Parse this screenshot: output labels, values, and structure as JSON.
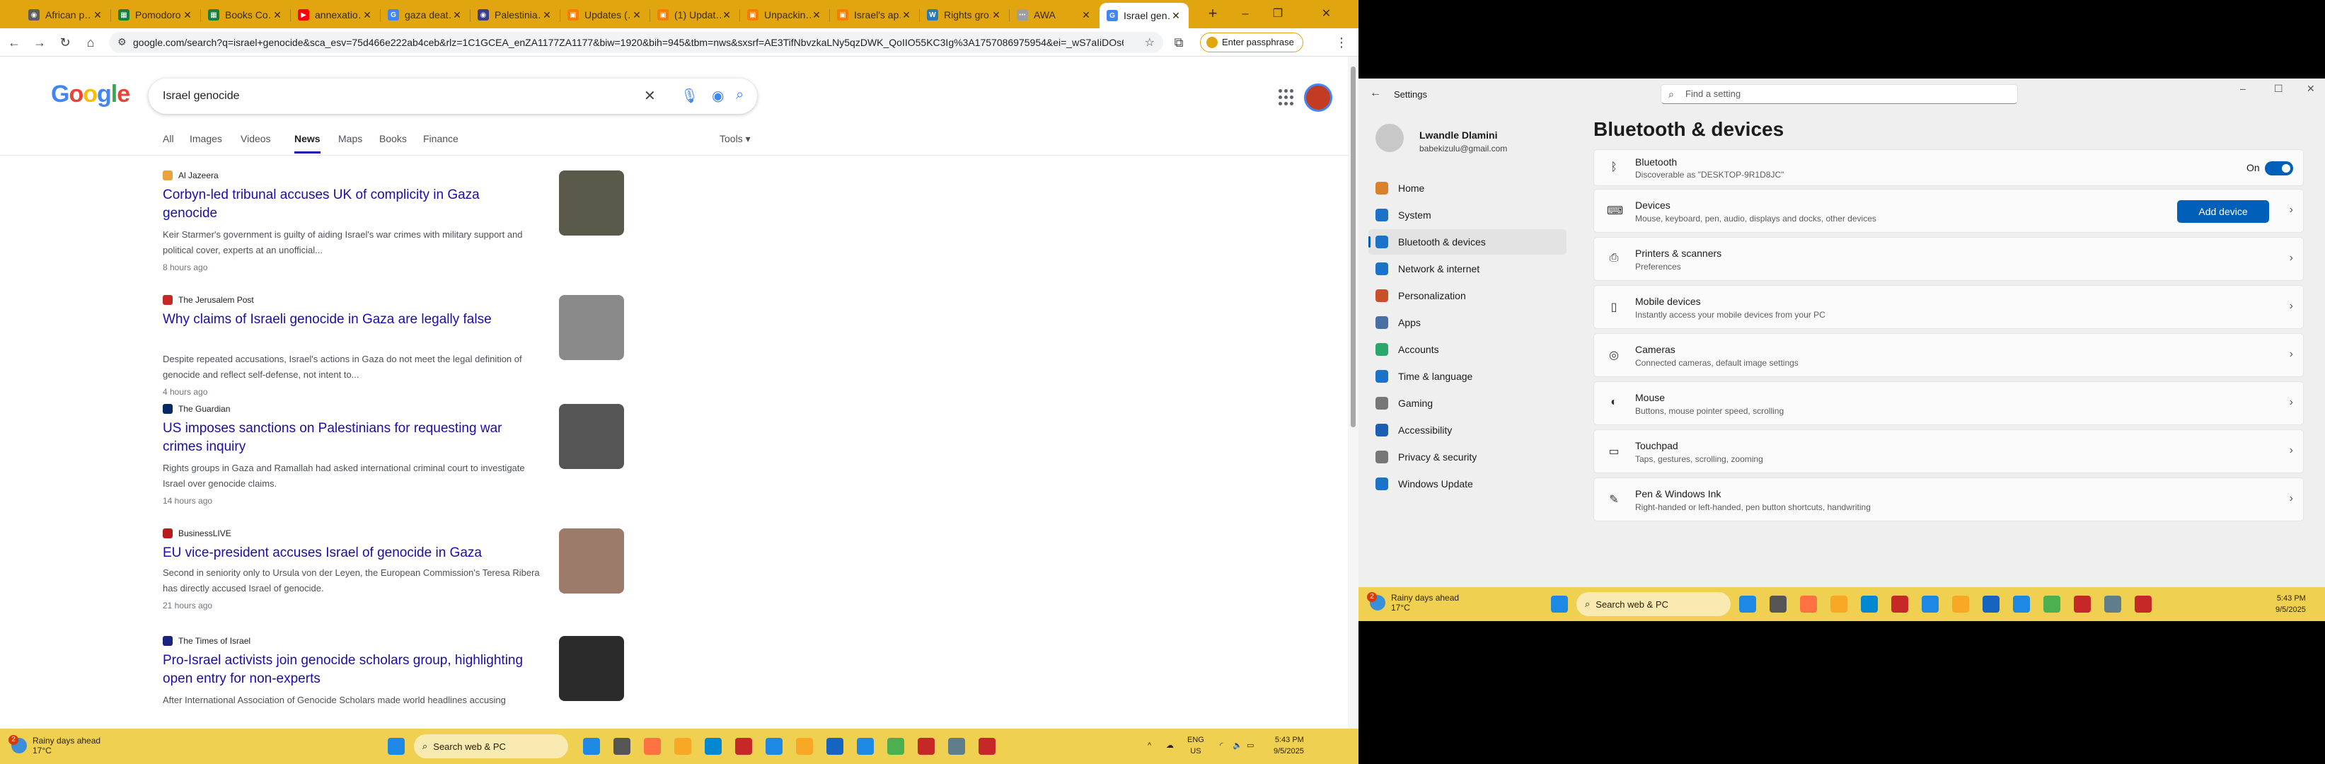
{
  "browser": {
    "tabs": [
      {
        "label": "African p…",
        "color": "#5c5c5c",
        "glyph": "◉"
      },
      {
        "label": "Pomodoro",
        "color": "#188038",
        "glyph": "▦"
      },
      {
        "label": "Books Co…",
        "color": "#188038",
        "glyph": "▦"
      },
      {
        "label": "annexatio…",
        "color": "#ff0000",
        "glyph": "▶"
      },
      {
        "label": "gaza deat…",
        "color": "#4285f4",
        "glyph": "G"
      },
      {
        "label": "Palestinia…",
        "color": "#3c3c8c",
        "glyph": "◉"
      },
      {
        "label": "Updates (…",
        "color": "#f57c00",
        "glyph": "▣"
      },
      {
        "label": "(1) Updat…",
        "color": "#f57c00",
        "glyph": "▣"
      },
      {
        "label": "Unpackin…",
        "color": "#f57c00",
        "glyph": "▣"
      },
      {
        "label": "Israel's ap…",
        "color": "#f57c00",
        "glyph": "▣"
      },
      {
        "label": "Rights gro…",
        "color": "#2a7ab8",
        "glyph": "W"
      },
      {
        "label": "AWA",
        "color": "#9e9e9e",
        "glyph": "⋯"
      },
      {
        "label": "Israel gen…",
        "color": "#4285f4",
        "glyph": "G"
      }
    ],
    "url": "google.com/search?q=israel+genocide&sca_esv=75d466e222ab4ceb&rlz=1C1GCEA_enZA1177ZA1177&biw=1920&bih=945&tbm=nws&sxsrf=AE3TifNbvzkaLNy5qzDWK_QoIIO55KC3Ig%3A1757086975954&ei=_wS7aIiDOs6Xxc8P...",
    "passphrase": "Enter passphrase"
  },
  "google": {
    "logo": "Google",
    "query": "Israel genocide",
    "tabs": [
      "All",
      "Images",
      "Videos",
      "News",
      "Maps",
      "Books",
      "Finance"
    ],
    "active_tab": "News",
    "tools": "Tools ▾",
    "results": [
      {
        "source": "Al Jazeera",
        "src_color": "#e8a33d",
        "title": "Corbyn-led tribunal accuses UK of complicity in Gaza genocide",
        "snippet": "Keir Starmer's government is guilty of aiding Israel's war crimes with military support and political cover, experts at an unofficial...",
        "age": "8 hours ago",
        "thumb": "#5a5a4a"
      },
      {
        "source": "The Jerusalem Post",
        "src_color": "#c62828",
        "title": "Why claims of Israeli genocide in Gaza are legally false",
        "snippet": "Despite repeated accusations, Israel's actions in Gaza do not meet the legal definition of genocide and reflect self-defense, not intent to...",
        "age": "4 hours ago",
        "thumb": "#8a8a8a"
      },
      {
        "source": "The Guardian",
        "src_color": "#052962",
        "title": "US imposes sanctions on Palestinians for requesting war crimes inquiry",
        "snippet": "Rights groups in Gaza and Ramallah had asked international criminal court to investigate Israel over genocide claims.",
        "age": "14 hours ago",
        "thumb": "#555555"
      },
      {
        "source": "BusinessLIVE",
        "src_color": "#b71c1c",
        "title": "EU vice-president accuses Israel of genocide in Gaza",
        "snippet": "Second in seniority only to Ursula von der Leyen, the European Commission's Teresa Ribera has directly accused Israel of genocide.",
        "age": "21 hours ago",
        "thumb": "#9c7b6a"
      },
      {
        "source": "The Times of Israel",
        "src_color": "#1a237e",
        "title": "Pro-Israel activists join genocide scholars group, highlighting open entry for non-experts",
        "snippet": "After International Association of Genocide Scholars made world headlines accusing",
        "age": "",
        "thumb": "#2b2b2b"
      }
    ]
  },
  "taskbar_left": {
    "weather_badge": "2",
    "weather_line1": "Rainy days ahead",
    "weather_line2": "17°C",
    "search": "Search web & PC",
    "lang1": "ENG",
    "lang2": "US",
    "time": "5:43 PM",
    "date": "9/5/2025",
    "tray_chevron": "^"
  },
  "settings": {
    "app_title": "Settings",
    "find_placeholder": "Find a setting",
    "profile_name": "Lwandle Dlamini",
    "profile_email": "babekizulu@gmail.com",
    "nav": [
      {
        "label": "Home",
        "color": "#d9822b"
      },
      {
        "label": "System",
        "color": "#1a73c8"
      },
      {
        "label": "Bluetooth & devices",
        "color": "#1a73c8"
      },
      {
        "label": "Network & internet",
        "color": "#1a73c8"
      },
      {
        "label": "Personalization",
        "color": "#c94f2b"
      },
      {
        "label": "Apps",
        "color": "#4a6fa5"
      },
      {
        "label": "Accounts",
        "color": "#2aa86a"
      },
      {
        "label": "Time & language",
        "color": "#1a73c8"
      },
      {
        "label": "Gaming",
        "color": "#777777"
      },
      {
        "label": "Accessibility",
        "color": "#1a5fb4"
      },
      {
        "label": "Privacy & security",
        "color": "#777777"
      },
      {
        "label": "Windows Update",
        "color": "#1a73c8"
      }
    ],
    "selected_nav": "Bluetooth & devices",
    "page_title": "Bluetooth & devices",
    "bluetooth": {
      "title": "Bluetooth",
      "subtitle": "Discoverable as \"DESKTOP-9R1D8JC\"",
      "state": "On"
    },
    "devices": {
      "title": "Devices",
      "subtitle": "Mouse, keyboard, pen, audio, displays and docks, other devices",
      "button": "Add device"
    },
    "items": [
      {
        "title": "Printers & scanners",
        "subtitle": "Preferences",
        "icon": "⎙"
      },
      {
        "title": "Mobile devices",
        "subtitle": "Instantly access your mobile devices from your PC",
        "icon": "▯"
      },
      {
        "title": "Cameras",
        "subtitle": "Connected cameras, default image settings",
        "icon": "◎"
      },
      {
        "title": "Mouse",
        "subtitle": "Buttons, mouse pointer speed, scrolling",
        "icon": "◐"
      },
      {
        "title": "Touchpad",
        "subtitle": "Taps, gestures, scrolling, zooming",
        "icon": "▭"
      },
      {
        "title": "Pen & Windows Ink",
        "subtitle": "Right-handed or left-handed, pen button shortcuts, handwriting",
        "icon": "✎"
      }
    ]
  },
  "taskbar_right": {
    "weather_badge": "2",
    "weather_line1": "Rainy days ahead",
    "weather_line2": "17°C",
    "search": "Search web & PC",
    "time": "5:43 PM",
    "date": "9/5/2025"
  },
  "taskbar_apps": [
    "#1e88e5",
    "#555555",
    "#ff7043",
    "#f9a825",
    "#0288d1",
    "#c62828",
    "#1e88e5",
    "#f9a825",
    "#1565c0",
    "#1e88e5",
    "#4caf50",
    "#c62828",
    "#607d8b",
    "#c62828"
  ]
}
